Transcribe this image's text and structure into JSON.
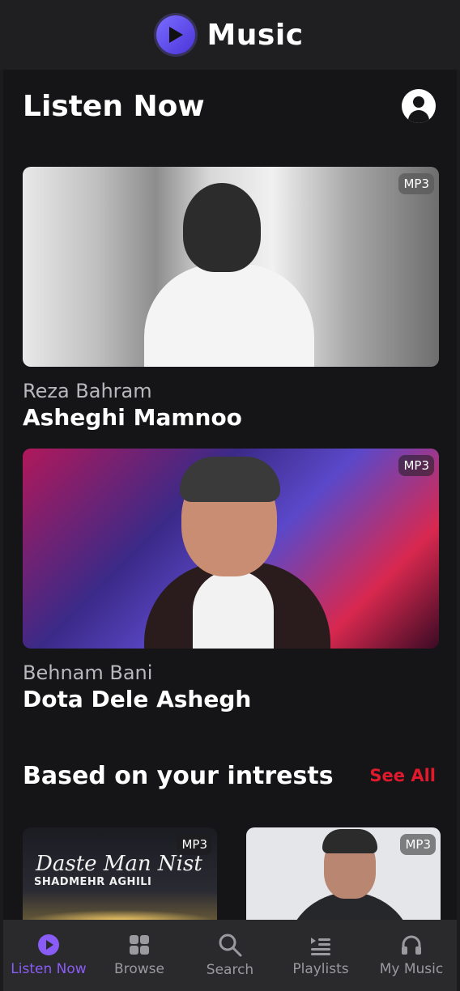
{
  "app": {
    "title": "Music"
  },
  "page": {
    "title": "Listen Now"
  },
  "featured": [
    {
      "artist": "Reza Bahram",
      "song": "Asheghi Mamnoo",
      "badge": "MP3"
    },
    {
      "artist": "Behnam Bani",
      "song": "Dota Dele Ashegh",
      "badge": "MP3"
    }
  ],
  "section": {
    "title": "Based on your intrests",
    "see_all": "See All"
  },
  "tiles": [
    {
      "badge": "MP3",
      "cover_title": "Daste Man Nist",
      "cover_artist": "SHADMEHR AGHILI"
    },
    {
      "badge": "MP3"
    }
  ],
  "tabs": [
    {
      "label": "Listen Now",
      "icon": "play-circle-icon"
    },
    {
      "label": "Browse",
      "icon": "grid-icon"
    },
    {
      "label": "Search",
      "icon": "search-icon"
    },
    {
      "label": "Playlists",
      "icon": "playlist-icon"
    },
    {
      "label": "My Music",
      "icon": "headphones-icon"
    }
  ],
  "colors": {
    "accent": "#8a5cf6",
    "see_all": "#e0192c",
    "background": "#151517"
  }
}
